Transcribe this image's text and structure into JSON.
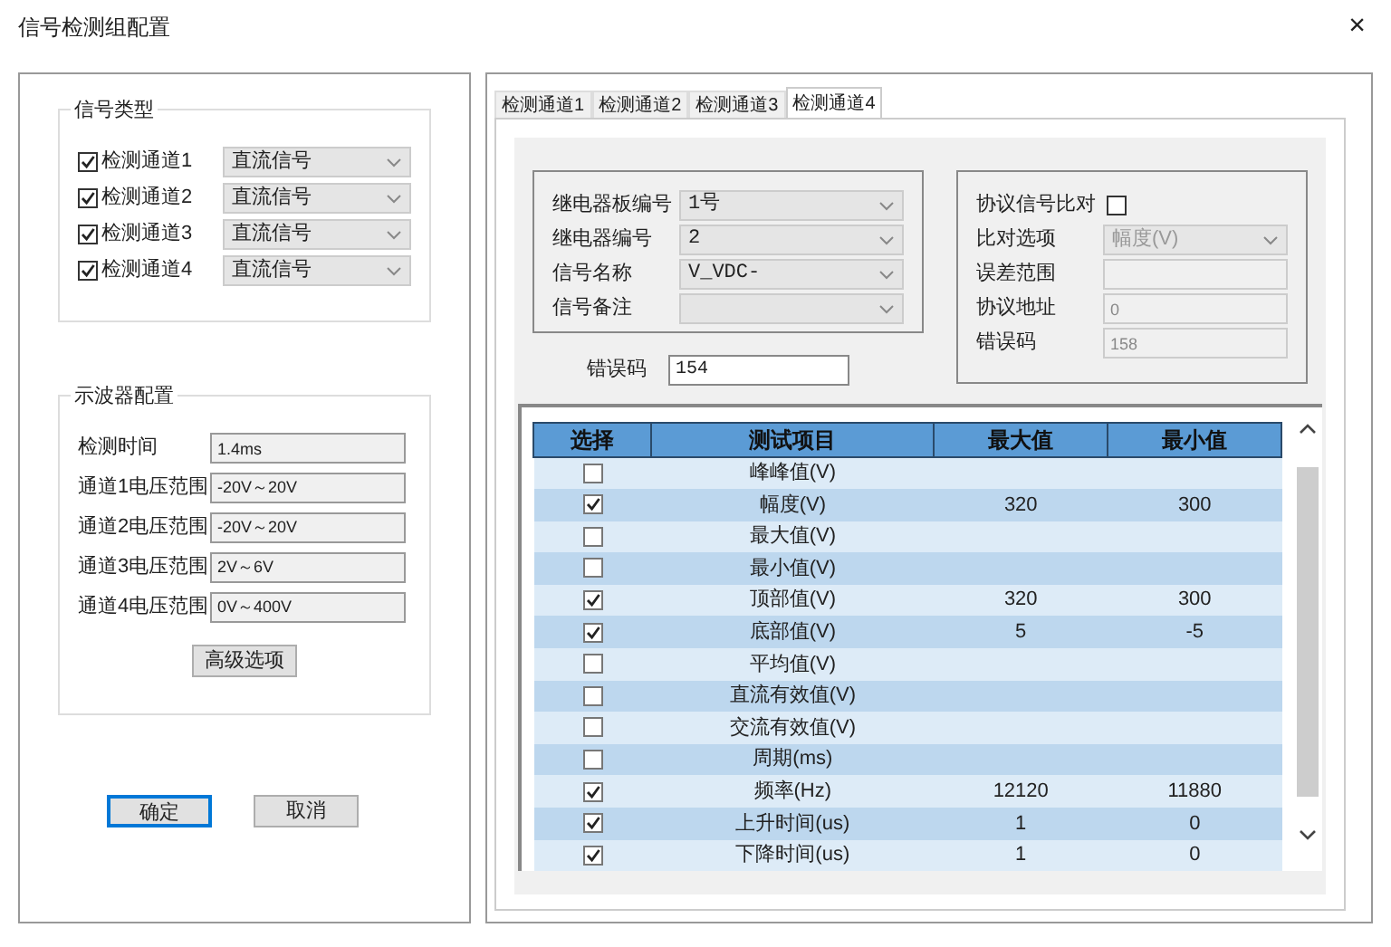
{
  "window": {
    "title": "信号检测组配置",
    "close": "×"
  },
  "signal_type": {
    "title": "信号类型",
    "channels": [
      {
        "label": "检测通道1",
        "checked": true,
        "value": "直流信号"
      },
      {
        "label": "检测通道2",
        "checked": true,
        "value": "直流信号"
      },
      {
        "label": "检测通道3",
        "checked": true,
        "value": "直流信号"
      },
      {
        "label": "检测通道4",
        "checked": true,
        "value": "直流信号"
      }
    ]
  },
  "oscilloscope": {
    "title": "示波器配置",
    "fields": [
      {
        "label": "检测时间",
        "value": "1.4ms"
      },
      {
        "label": "通道1电压范围",
        "value": "-20V～20V"
      },
      {
        "label": "通道2电压范围",
        "value": "-20V～20V"
      },
      {
        "label": "通道3电压范围",
        "value": "2V～6V"
      },
      {
        "label": "通道4电压范围",
        "value": "0V～400V"
      }
    ],
    "advanced_button": "高级选项"
  },
  "buttons": [
    {
      "label": "确定",
      "kind": "default"
    },
    {
      "label": "取消",
      "kind": "normal"
    }
  ],
  "tabs": [
    {
      "label": "检测通道1",
      "selected": false
    },
    {
      "label": "检测通道2",
      "selected": false
    },
    {
      "label": "检测通道3",
      "selected": false
    },
    {
      "label": "检测通道4",
      "selected": true
    }
  ],
  "relay": {
    "fields": [
      {
        "label": "继电器板编号",
        "value": "1号"
      },
      {
        "label": "继电器编号",
        "value": "2"
      },
      {
        "label": "信号名称",
        "value": "V_VDC-"
      },
      {
        "label": "信号备注"
      }
    ],
    "error_code": {
      "label": "错误码",
      "value": "154"
    }
  },
  "protocol": {
    "compare": {
      "label": "协议信号比对",
      "checked": false
    },
    "fields": [
      {
        "label": "比对选项",
        "kind": "dropdown",
        "value": "幅度(V)"
      },
      {
        "label": "误差范围",
        "kind": "input"
      },
      {
        "label": "协议地址",
        "kind": "input",
        "value": "0"
      },
      {
        "label": "错误码",
        "kind": "input",
        "value": "158"
      }
    ]
  },
  "table": {
    "columns": [
      "选择",
      "测试项目",
      "最大值",
      "最小值"
    ],
    "rows": [
      {
        "selected": false,
        "item": "峰峰值(V)"
      },
      {
        "selected": true,
        "item": "幅度(V)",
        "max": "320",
        "min": "300"
      },
      {
        "selected": false,
        "item": "最大值(V)"
      },
      {
        "selected": false,
        "item": "最小值(V)"
      },
      {
        "selected": true,
        "item": "顶部值(V)",
        "max": "320",
        "min": "300"
      },
      {
        "selected": true,
        "item": "底部值(V)",
        "max": "5",
        "min": "-5"
      },
      {
        "selected": false,
        "item": "平均值(V)"
      },
      {
        "selected": false,
        "item": "直流有效值(V)"
      },
      {
        "selected": false,
        "item": "交流有效值(V)"
      },
      {
        "selected": false,
        "item": "周期(ms)"
      },
      {
        "selected": true,
        "item": "频率(Hz)",
        "max": "12120",
        "min": "11880"
      },
      {
        "selected": true,
        "item": "上升时间(us)",
        "max": "1",
        "min": "0"
      },
      {
        "selected": true,
        "item": "下降时间(us)",
        "max": "1",
        "min": "0"
      }
    ]
  }
}
